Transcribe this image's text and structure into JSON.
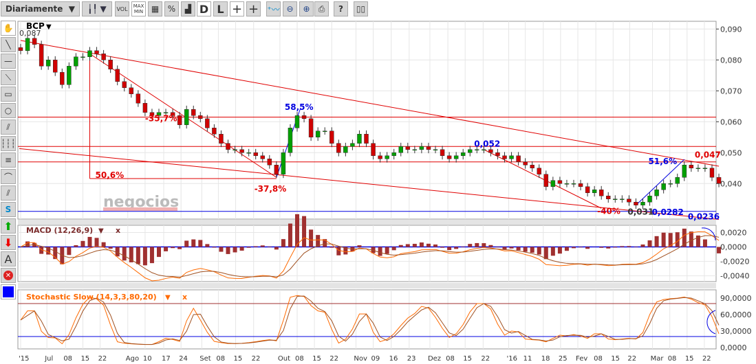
{
  "toolbar": {
    "period": "Diariamente",
    "vol": "VOL",
    "maxmin_top": "MAX",
    "maxmin_bottom": "MIN",
    "percent": "%",
    "d": "D",
    "l": "L",
    "help": "?"
  },
  "side_tools": [
    "hand",
    "line",
    "horizontal-line",
    "parallel-lines",
    "rectangle",
    "circle",
    "fan",
    "fibonacci-vertical",
    "fibonacci-horizontal",
    "arc",
    "channel",
    "s-channel",
    "buy-arrow",
    "sell-arrow",
    "text",
    "delete",
    "color"
  ],
  "side_text": {
    "s": "S",
    "a": "A"
  },
  "chart_data": {
    "type": "candlestick",
    "symbol": "BCP",
    "first_value_label": "0,087",
    "closes": [
      0.083,
      0.087,
      0.085,
      0.078,
      0.08,
      0.076,
      0.072,
      0.078,
      0.081,
      0.081,
      0.083,
      0.082,
      0.08,
      0.077,
      0.073,
      0.071,
      0.069,
      0.066,
      0.063,
      0.062,
      0.063,
      0.063,
      0.062,
      0.059,
      0.064,
      0.062,
      0.061,
      0.058,
      0.056,
      0.053,
      0.051,
      0.051,
      0.05,
      0.05,
      0.049,
      0.048,
      0.046,
      0.043,
      0.05,
      0.058,
      0.062,
      0.061,
      0.055,
      0.057,
      0.057,
      0.053,
      0.05,
      0.052,
      0.053,
      0.056,
      0.053,
      0.049,
      0.048,
      0.049,
      0.05,
      0.052,
      0.051,
      0.051,
      0.052,
      0.051,
      0.051,
      0.049,
      0.048,
      0.049,
      0.05,
      0.051,
      0.051,
      0.051,
      0.05,
      0.049,
      0.048,
      0.049,
      0.047,
      0.046,
      0.045,
      0.043,
      0.039,
      0.041,
      0.04,
      0.04,
      0.04,
      0.039,
      0.037,
      0.038,
      0.036,
      0.035,
      0.035,
      0.035,
      0.034,
      0.033,
      0.034,
      0.036,
      0.038,
      0.04,
      0.04,
      0.042,
      0.046,
      0.045,
      0.045,
      0.045,
      0.042,
      0.04
    ],
    "price_axis": {
      "ticks": [
        "0,090",
        "0,080",
        "0,070",
        "0,060",
        "0,050",
        "0,040"
      ],
      "values": [
        0.09,
        0.08,
        0.07,
        0.06,
        0.05,
        0.04
      ],
      "range": [
        0.0285,
        0.0925
      ]
    },
    "x_labels": [
      "'15",
      "Jul",
      "08",
      "15",
      "22",
      "Ago",
      "10",
      "17",
      "24",
      "Set",
      "08",
      "15",
      "22",
      "Out",
      "08",
      "15",
      "22",
      "Nov",
      "09",
      "16",
      "23",
      "Dez",
      "08",
      "15",
      "22",
      "'16",
      "11",
      "18",
      "25",
      "Fev",
      "08",
      "15",
      "22",
      "Mar",
      "08",
      "15",
      "22"
    ],
    "x_label_index": [
      0,
      3.8,
      6.5,
      9,
      11.5,
      15.5,
      18,
      20.7,
      23.2,
      26.2,
      28.6,
      31.1,
      33.7,
      37.5,
      40,
      42.5,
      45,
      48.5,
      51,
      53.6,
      56.2,
      59.2,
      61.8,
      64.3,
      66.9,
      70.6,
      73,
      75.6,
      78.1,
      80.6,
      83.2,
      85.7,
      88.1,
      91.4,
      93.9,
      96.4,
      98.9
    ],
    "horizontal_lines": [
      {
        "price": 0.0615,
        "color": "#e00000"
      },
      {
        "price": 0.052,
        "color": "#e00000"
      },
      {
        "price": 0.047,
        "color": "#e00000"
      },
      {
        "price": 0.031,
        "color": "#0000e0"
      }
    ],
    "trend_lines": [
      {
        "from": [
          0,
          0.0863
        ],
        "to": [
          101,
          0.0456
        ],
        "color": "#e00000"
      },
      {
        "from": [
          -0.2,
          0.0513
        ],
        "to": [
          101,
          0.0284
        ],
        "color": "#e00000"
      },
      {
        "from": [
          10,
          0.082
        ],
        "to": [
          37,
          0.042
        ],
        "color": "#e00000"
      },
      {
        "from": [
          10,
          0.082
        ],
        "to": [
          10,
          0.0416
        ],
        "color": "#e00000"
      },
      {
        "from": [
          10,
          0.0416
        ],
        "to": [
          37,
          0.0416
        ],
        "color": "#e00000"
      },
      {
        "from": [
          67,
          0.051
        ],
        "to": [
          84,
          0.032
        ],
        "color": "#e00000"
      },
      {
        "from": [
          37,
          0.042
        ],
        "to": [
          40.5,
          0.0645
        ],
        "color": "#0000e0"
      },
      {
        "from": [
          89,
          0.033
        ],
        "to": [
          96,
          0.0478
        ],
        "color": "#0000e0"
      }
    ],
    "annotations": [
      {
        "text": "-35,7%",
        "at": [
          18,
          0.0602
        ],
        "color": "#e00000"
      },
      {
        "text": "50,6%",
        "at": [
          10.8,
          0.0418
        ],
        "color": "#e00000"
      },
      {
        "text": "-37,8%",
        "at": [
          33.8,
          0.0374
        ],
        "color": "#e00000"
      },
      {
        "text": "58,5%",
        "at": [
          38.2,
          0.0638
        ],
        "color": "#0000e0"
      },
      {
        "text": "0,052",
        "at": [
          65.6,
          0.0519
        ],
        "color": "#0000e0"
      },
      {
        "text": "-40%",
        "at": [
          83.4,
          0.0302
        ],
        "color": "#e00000"
      },
      {
        "text": "0,031",
        "at": [
          87.8,
          0.03
        ],
        "color": "#333333"
      },
      {
        "text": "0,0282",
        "at": [
          91.3,
          0.0298
        ],
        "color": "#0000e0"
      },
      {
        "text": "0,0236",
        "at": [
          96.5,
          0.0284
        ],
        "color": "#0000e0"
      },
      {
        "text": "51,6%",
        "at": [
          90.8,
          0.0463
        ],
        "color": "#0000e0"
      },
      {
        "text": "0,047",
        "at": [
          97.5,
          0.0484
        ],
        "color": "#e00000"
      }
    ],
    "watermark": "negocios",
    "macd": {
      "title": "MACD (12,26,9)",
      "close": "x",
      "ticks": [
        "0,0020",
        "0,0000",
        "-0,0020",
        "-0,0040"
      ],
      "values": [
        0.002,
        0,
        -0.002,
        -0.004
      ],
      "range": [
        -0.0048,
        0.003
      ]
    },
    "stochastic": {
      "title": "Stochastic Slow (14,3,3,80,20)",
      "close": "x",
      "ticks": [
        "90,0000",
        "60,0000",
        "30,0000",
        "0,0000"
      ],
      "values": [
        90,
        60,
        30,
        0
      ],
      "levels": [
        80,
        20
      ],
      "range": [
        0,
        100
      ]
    },
    "colors": {
      "up": "#00a000",
      "down": "#d00000",
      "macd_line": "#ff6a00",
      "signal": "#a05020",
      "hist": "#a03030",
      "title": "#7a2a2a",
      "stoch_title": "#ff6a00"
    }
  }
}
